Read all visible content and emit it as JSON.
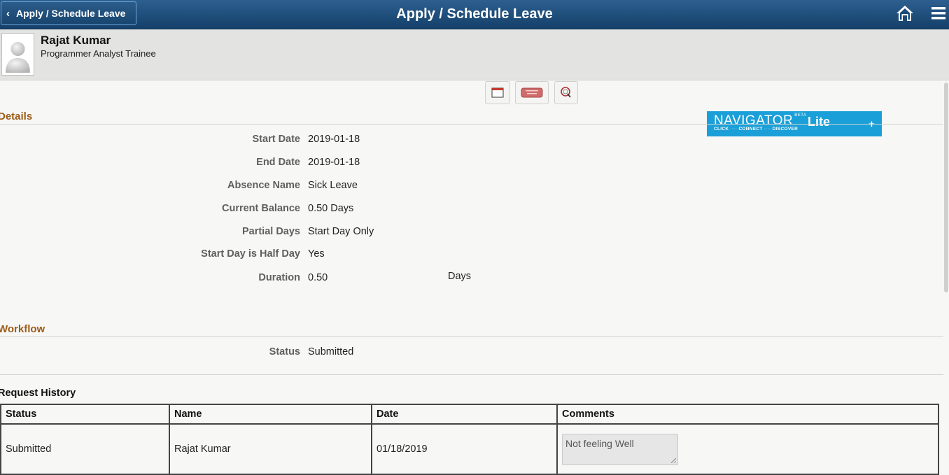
{
  "header": {
    "back_label": "Apply / Schedule Leave",
    "title": "Apply / Schedule Leave",
    "home_icon": "home-icon",
    "menu_icon": "hamburger-menu-icon"
  },
  "employee": {
    "name": "Rajat Kumar",
    "job_title": "Programmer Analyst Trainee"
  },
  "navigator": {
    "word": "NAVIGATOR",
    "beta": "BETA",
    "lite": "Lite",
    "sub_click": "CLICK",
    "sub_connect": "CONNECT",
    "sub_discover": "DISCOVER",
    "plus": "+"
  },
  "details": {
    "title": "Details",
    "start_date_label": "Start Date",
    "start_date": "2019-01-18",
    "end_date_label": "End Date",
    "end_date": "2019-01-18",
    "absence_name_label": "Absence Name",
    "absence_name": "Sick Leave",
    "current_balance_label": "Current Balance",
    "current_balance": "0.50 Days",
    "partial_days_label": "Partial Days",
    "partial_days": "Start Day Only",
    "half_day_label": "Start Day is Half Day",
    "half_day": "Yes",
    "duration_label": "Duration",
    "duration": "0.50",
    "duration_unit": "Days"
  },
  "workflow": {
    "title": "Workflow",
    "status_label": "Status",
    "status": "Submitted"
  },
  "request_history": {
    "title": "Request History",
    "columns": [
      "Status",
      "Name",
      "Date",
      "Comments"
    ],
    "rows": [
      {
        "status": "Submitted",
        "name": "Rajat Kumar",
        "date": "01/18/2019",
        "comments": "Not feeling Well"
      }
    ]
  }
}
